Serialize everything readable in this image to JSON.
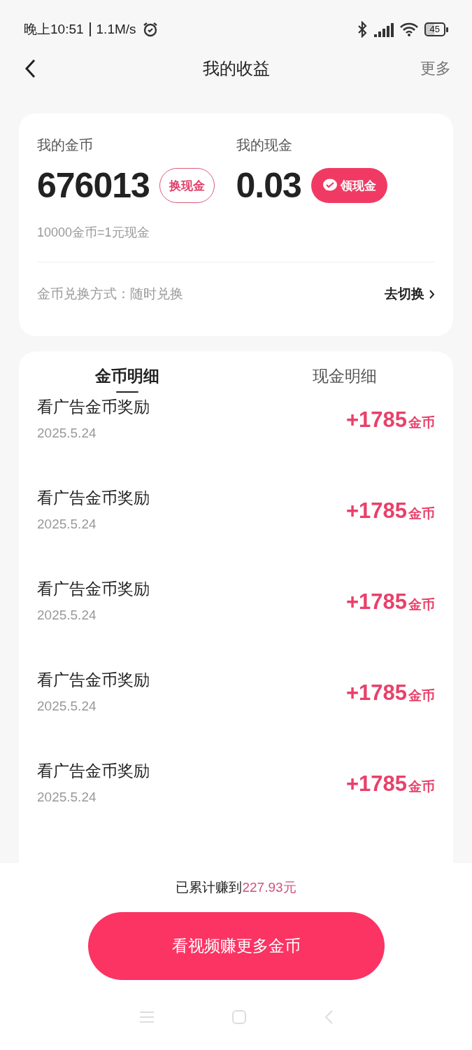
{
  "status_bar": {
    "time": "晚上10:51",
    "speed": "1.1M/s",
    "battery": "45"
  },
  "header": {
    "title": "我的收益",
    "action": "更多"
  },
  "balances": [
    {
      "label": "我的金币",
      "value": "676013",
      "button": "换现金",
      "kind": "outline"
    },
    {
      "label": "我的现金",
      "value": "0.03",
      "button": "领现金",
      "kind": "filled"
    }
  ],
  "rate": "10000金币=1元现金",
  "exchange": {
    "label": "金币兑换方式：随时兑换",
    "link": "去切换"
  },
  "tabs": [
    {
      "label": "金币明细",
      "selected": true
    },
    {
      "label": "现金明细",
      "selected": false
    }
  ],
  "records": [
    {
      "title": "看广告金币奖励",
      "date": "2025.5.24",
      "amount": "+1785",
      "unit": "金币"
    },
    {
      "title": "看广告金币奖励",
      "date": "2025.5.24",
      "amount": "+1785",
      "unit": "金币"
    },
    {
      "title": "看广告金币奖励",
      "date": "2025.5.24",
      "amount": "+1785",
      "unit": "金币"
    },
    {
      "title": "看广告金币奖励",
      "date": "2025.5.24",
      "amount": "+1785",
      "unit": "金币"
    },
    {
      "title": "看广告金币奖励",
      "date": "2025.5.24",
      "amount": "+1785",
      "unit": "金币"
    }
  ],
  "footer": {
    "earned_label": "已累计赚到",
    "earned_amount": "227.93元",
    "button": "看视频赚更多金币"
  }
}
